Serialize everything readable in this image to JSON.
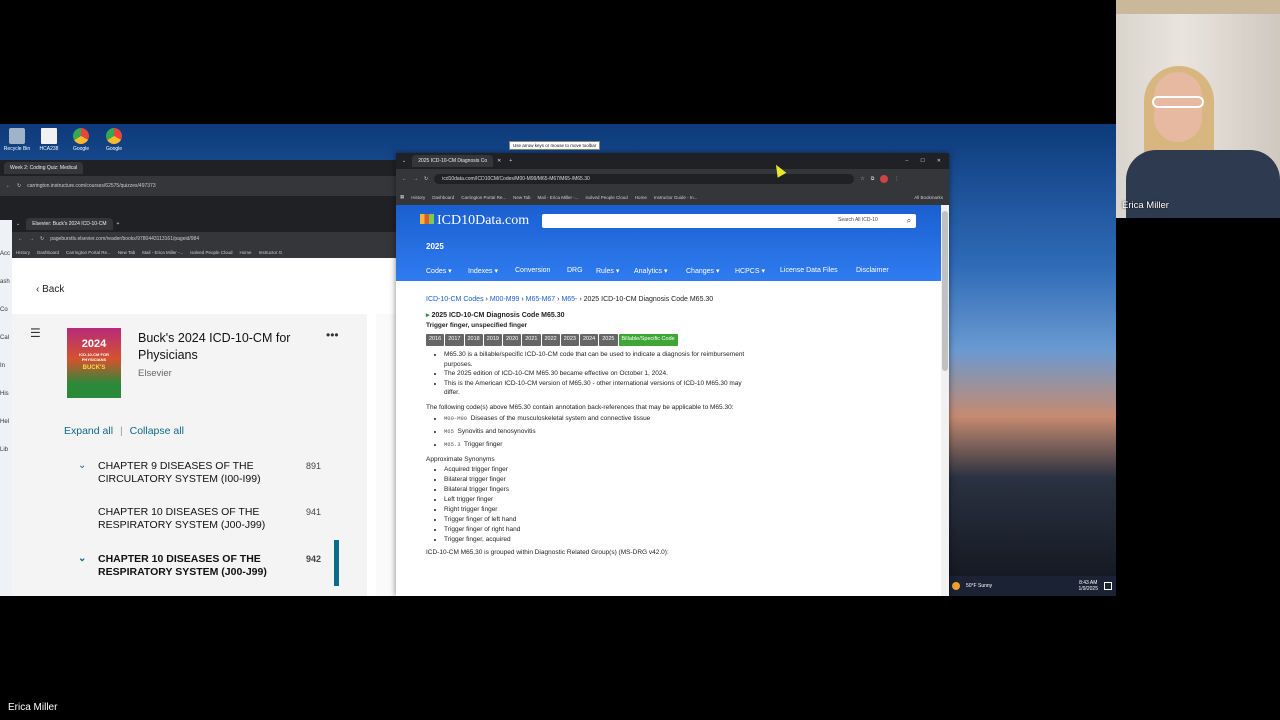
{
  "desktop": {
    "icons": [
      {
        "label": "Recycle Bin",
        "color": "#9fb4c8"
      },
      {
        "label": "HCA238",
        "color": "#f2f2f2"
      },
      {
        "label": "Google",
        "color": "#e8453c"
      },
      {
        "label": "Google",
        "color": "#e8453c"
      }
    ],
    "tooltip": "Use arrow keys or mouse to move toolbar",
    "taskbar": {
      "weather": "50°F  Sunny",
      "time": "8:43 AM",
      "date": "1/9/2025"
    }
  },
  "canvas_window": {
    "tab": "Week 2: Coding Quiz: Medical",
    "url": "carrington.instructure.com/courses/62575/quizzes/497373"
  },
  "elsevier_window": {
    "tab": "Elsevier: Buck's 2024 ICD-10-CM",
    "url": "pageburstls.elsevier.com/reader/books/9780443113161/pageid/984",
    "bookmarks": [
      "History",
      "Dashboard",
      "Carrington Portal Re...",
      "New Tab",
      "Mail - Erica Miller -...",
      "isolved People Cloud",
      "Home",
      "Instructor G"
    ],
    "back_label": "Back",
    "book_title": "Buck's 2024 ICD-10-CM for Physicians",
    "publisher": "Elsevier",
    "cover_year": "2024",
    "cover_title": "ICD-10-CM FOR PHYSICIANS",
    "cover_brand": "BUCK'S",
    "expand_all": "Expand all",
    "separator": "|",
    "collapse_all": "Collapse all",
    "chapters": [
      {
        "title": "CHAPTER 9 DISEASES OF THE CIRCULATORY SYSTEM (I00-I99)",
        "page": "891",
        "chevron": "⌄",
        "bold": false
      },
      {
        "title": "CHAPTER 10 DISEASES OF THE RESPIRATORY SYSTEM (J00-J99)",
        "page": "941",
        "chevron": "",
        "bold": false
      },
      {
        "title": "CHAPTER 10 DISEASES OF THE RESPIRATORY SYSTEM (J00-J99)",
        "page": "942",
        "chevron": "⌄",
        "bold": true
      }
    ],
    "left_strip": [
      "Acc",
      "ash",
      "Co",
      "Cal",
      "In",
      "His",
      "Hel",
      "Lib"
    ]
  },
  "icd_window": {
    "tab": "2025 ICD-10-CM Diagnosis Co",
    "url": "icd10data.com/ICD10CM/Codes/M00-M99/M65-M67/M65-/M65.30",
    "bookmarks": [
      "History",
      "Dashboard",
      "Carrington Portal Re...",
      "New Tab",
      "Mail - Erica Miller -...",
      "isolved People Cloud",
      "Home",
      "Instructor Guide - In..."
    ],
    "all_bookmarks": "All Bookmarks",
    "logo": "ICD10Data.com",
    "year": "2025",
    "search_placeholder": "Search All ICD-10",
    "nav": [
      "Codes ▾",
      "Indexes ▾",
      "Conversion",
      "DRG",
      "Rules ▾",
      "Analytics ▾",
      "Changes ▾",
      "HCPCS ▾",
      "License Data Files",
      "Disclaimer"
    ],
    "breadcrumb": [
      "ICD-10-CM Codes",
      "M00-M99",
      "M65-M67",
      "M65-"
    ],
    "breadcrumb_tail": "2025 ICD-10-CM Diagnosis Code M65.30",
    "code_heading": "2025 ICD-10-CM Diagnosis Code M65.30",
    "code_desc": "Trigger finger, unspecified finger",
    "years": [
      "2016",
      "2017",
      "2018",
      "2019",
      "2020",
      "2021",
      "2022",
      "2023",
      "2024",
      "2025"
    ],
    "billable_badge": "Billable/Specific Code",
    "bullets": [
      "M65.30 is a billable/specific ICD-10-CM code that can be used to indicate a diagnosis for reimbursement purposes.",
      "The 2025 edition of ICD-10-CM M65.30 became effective on October 1, 2024.",
      "This is the American ICD-10-CM version of M65.30 - other international versions of ICD-10 M65.30 may differ."
    ],
    "backref_intro": "The following code(s) above M65.30 contain annotation back-references that may be applicable to M65.30:",
    "backrefs": [
      {
        "code": "M00-M99",
        "text": "Diseases of the musculoskeletal system and connective tissue"
      },
      {
        "code": "M65",
        "text": "Synovitis and tenosynovitis"
      },
      {
        "code": "M65.3",
        "text": "Trigger finger"
      }
    ],
    "synonyms_heading": "Approximate Synonyms",
    "synonyms": [
      "Acquired trigger finger",
      "Bilateral trigger finger",
      "Bilateral trigger fingers",
      "Left trigger finger",
      "Right trigger finger",
      "Trigger finger of left hand",
      "Trigger finger of right hand",
      "Trigger finger, acquired"
    ],
    "drg_line": "ICD-10-CM M65.30 is grouped within Diagnostic Related Group(s) (MS-DRG v42.0):"
  },
  "webcam": {
    "name": "Erica Miller"
  },
  "caption": {
    "name": "Erica Miller"
  }
}
